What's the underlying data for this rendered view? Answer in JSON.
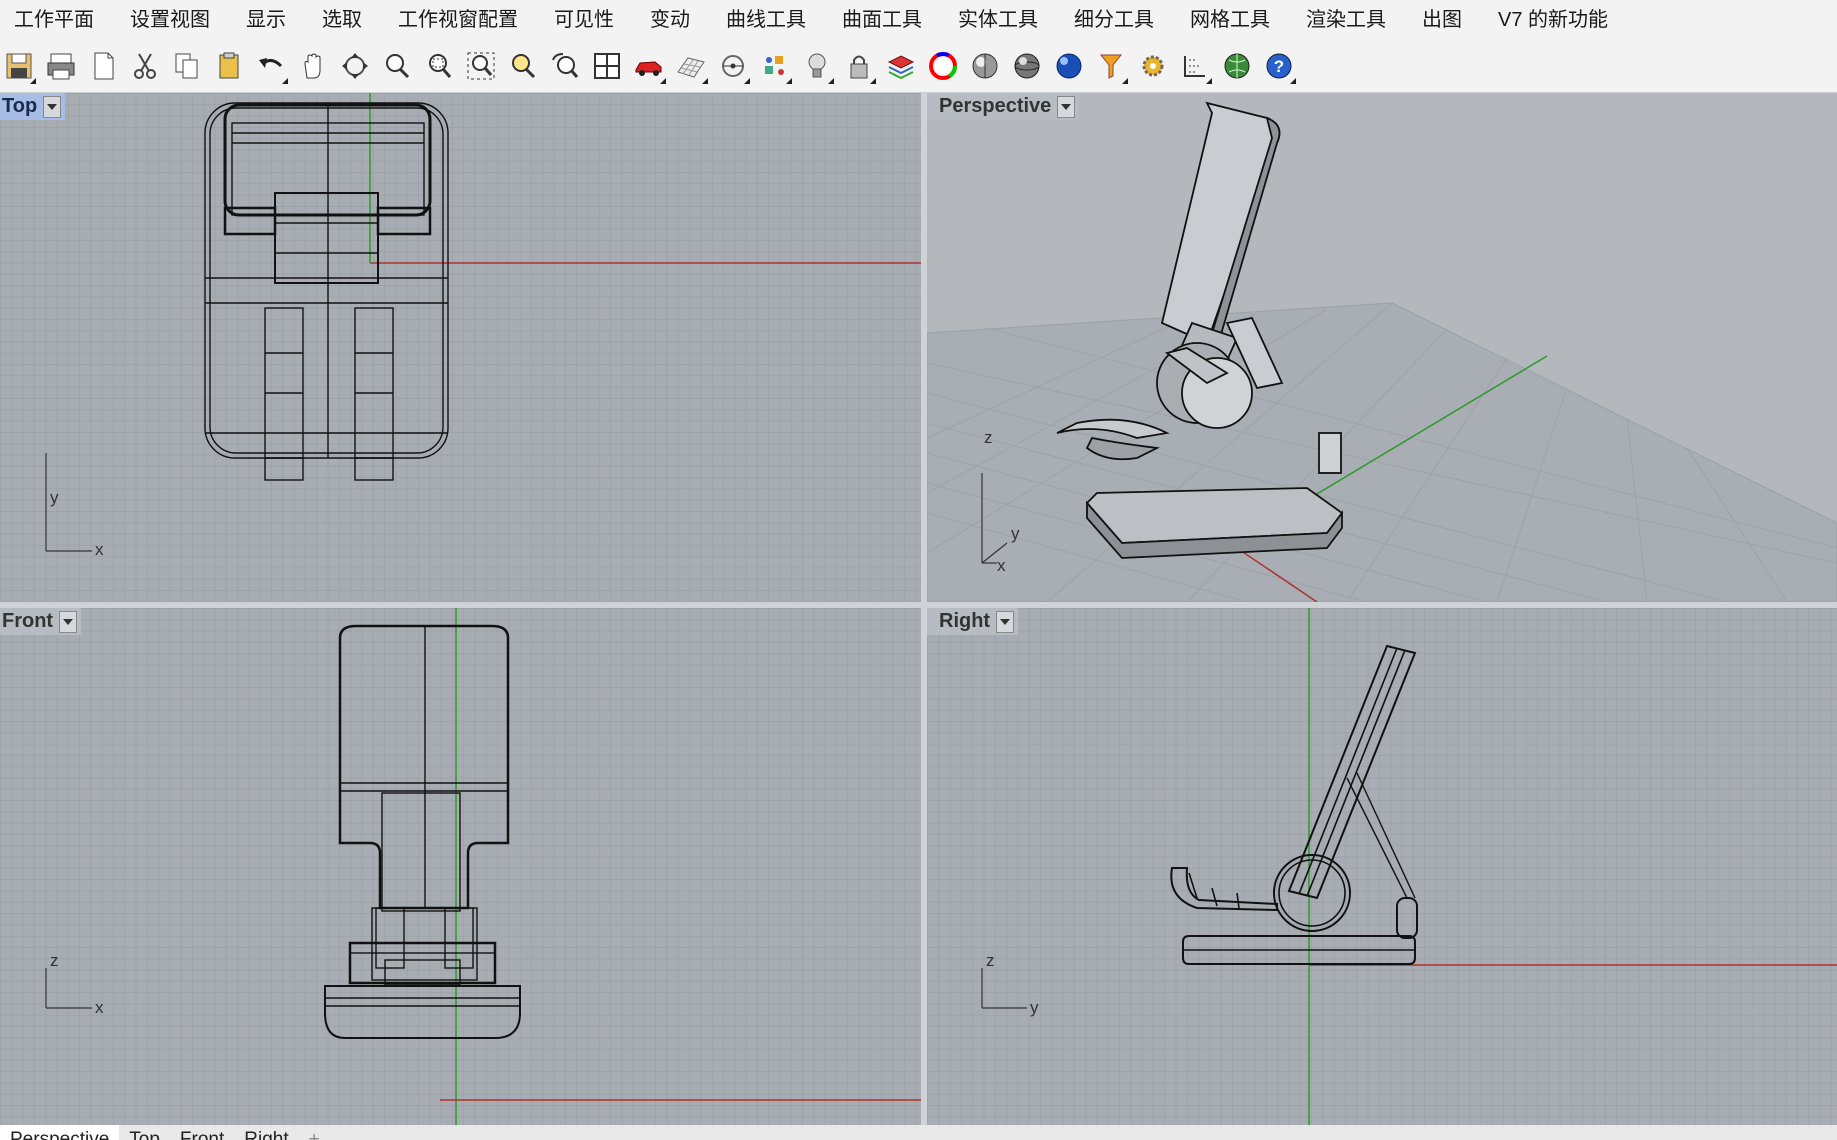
{
  "menu": [
    "工作平面",
    "设置视图",
    "显示",
    "选取",
    "工作视窗配置",
    "可见性",
    "变动",
    "曲线工具",
    "曲面工具",
    "实体工具",
    "细分工具",
    "网格工具",
    "渲染工具",
    "出图",
    "V7 的新功能"
  ],
  "toolbar": [
    {
      "name": "save-icon",
      "menu": true
    },
    {
      "name": "print-icon",
      "menu": false
    },
    {
      "name": "new-document-icon",
      "menu": false
    },
    {
      "name": "cut-icon",
      "menu": false
    },
    {
      "name": "copy-icon",
      "menu": false
    },
    {
      "name": "paste-icon",
      "menu": false
    },
    {
      "name": "undo-icon",
      "menu": true
    },
    {
      "name": "pan-hand-icon",
      "menu": false
    },
    {
      "name": "rotate-view-icon",
      "menu": false
    },
    {
      "name": "zoom-icon",
      "menu": false
    },
    {
      "name": "zoom-window-icon",
      "menu": false
    },
    {
      "name": "zoom-extents-icon",
      "menu": false
    },
    {
      "name": "zoom-selected-icon",
      "menu": false
    },
    {
      "name": "undo-view-icon",
      "menu": false
    },
    {
      "name": "four-viewports-icon",
      "menu": false
    },
    {
      "name": "car-icon",
      "menu": true
    },
    {
      "name": "grid-icon",
      "menu": true
    },
    {
      "name": "snap-point-icon",
      "menu": true
    },
    {
      "name": "gumball-icon",
      "menu": true
    },
    {
      "name": "light-bulb-icon",
      "menu": true
    },
    {
      "name": "lock-icon",
      "menu": true
    },
    {
      "name": "layers-icon",
      "menu": false
    },
    {
      "name": "color-wheel-icon",
      "menu": false
    },
    {
      "name": "shaded-sphere-icon",
      "menu": false
    },
    {
      "name": "rendered-sphere-icon",
      "menu": false
    },
    {
      "name": "blue-sphere-icon",
      "menu": false
    },
    {
      "name": "select-filter-icon",
      "menu": true
    },
    {
      "name": "gear-icon",
      "menu": false
    },
    {
      "name": "dimension-icon",
      "menu": true
    },
    {
      "name": "globe-icon",
      "menu": false
    },
    {
      "name": "help-icon",
      "menu": true
    }
  ],
  "viewports": {
    "top": {
      "label": "Top",
      "axis1": "y",
      "axis2": "x"
    },
    "perspective": {
      "label": "Perspective",
      "axis1": "z",
      "axis2": "y",
      "axis3": "x"
    },
    "front": {
      "label": "Front",
      "axis1": "z",
      "axis2": "x"
    },
    "right": {
      "label": "Right",
      "axis1": "z",
      "axis2": "y"
    }
  },
  "tabs": [
    "Perspective",
    "Top",
    "Front",
    "Right"
  ],
  "colors": {
    "viewport_bg": "#a8adb3",
    "active_label": "#a8bde6",
    "x_axis": "#b03030",
    "y_axis": "#2a9a2a"
  }
}
